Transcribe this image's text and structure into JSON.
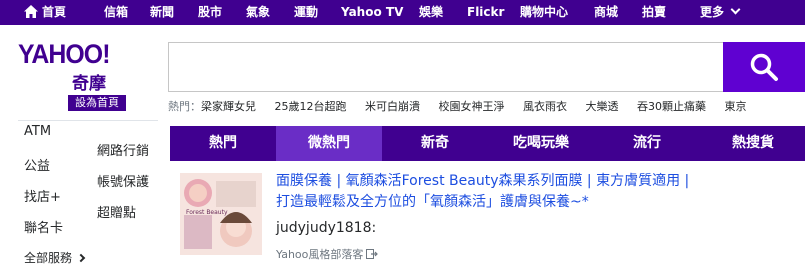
{
  "topnav": {
    "home": "首頁",
    "items": [
      "信箱",
      "新聞",
      "股市",
      "氣象",
      "運動",
      "Yahoo TV",
      "娛樂",
      "Flickr",
      "購物中心",
      "商城",
      "拍賣"
    ],
    "more": "更多"
  },
  "header": {
    "logo_text": "YAHOO!",
    "logo_sub": "奇摩",
    "set_home": "設為首頁",
    "search_placeholder": "",
    "search_value": ""
  },
  "trending": {
    "label": "熱門：",
    "items": [
      "梁家輝女兒",
      "25歲12台超跑",
      "米可白崩潰",
      "校園女神王淨",
      "風衣雨衣",
      "大樂透",
      "吞30顆止痛藥",
      "東京"
    ]
  },
  "sidebar": {
    "col1": [
      "ATM",
      "公益",
      "找店+",
      "聯名卡"
    ],
    "col2": [
      "網路行銷",
      "帳號保護",
      "超贈點"
    ],
    "more": "全部服務"
  },
  "tabs": {
    "items": [
      "熱門",
      "微熱門",
      "新奇",
      "吃喝玩樂",
      "流行",
      "熱搜貨"
    ],
    "active": "微熱門"
  },
  "article": {
    "title_line1": "面膜保養 | 氧顏森活Forest Beauty森果系列面膜 | 東方膚質適用 |",
    "title_line2": "打造最輕鬆及全方位的「氧顏森活」護膚與保養~*",
    "author": "judyjudy1818:",
    "source": "Yahoo風格部落客",
    "thumb_text": "Forest Beauty"
  },
  "colors": {
    "brand_purple": "#400090",
    "tab_active": "#6a2dc6",
    "search_button": "#5f01d1",
    "link_blue": "#1d4ee0"
  }
}
